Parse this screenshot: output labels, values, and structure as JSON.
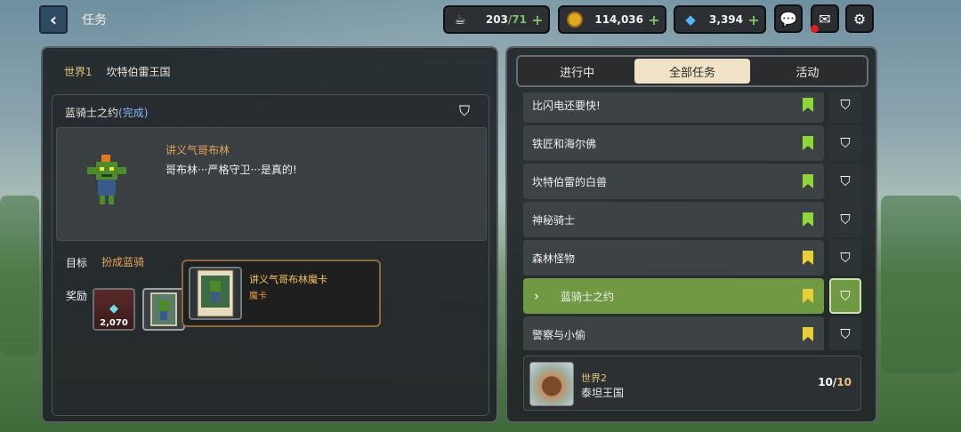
{
  "header": {
    "back_icon": "back-arrow-icon",
    "title": "任务",
    "resources": [
      {
        "name": "stamina",
        "icon": "coffee-cup-icon",
        "value": "203",
        "max": "71"
      },
      {
        "name": "gold",
        "icon": "gold-coin-icon",
        "value": "114,036"
      },
      {
        "name": "gems",
        "icon": "diamond-icon",
        "value": "3,394"
      }
    ],
    "plus_symbol": "+",
    "buttons": [
      "chat-icon",
      "mail-icon",
      "settings-gear-icon"
    ]
  },
  "left": {
    "world_label": "世界1",
    "kingdom": "坎特伯雷王国",
    "quest_title": "蓝骑士之约",
    "quest_status": "(完成)",
    "speaker": "讲义气哥布林",
    "speech": "哥布林···严格守卫···是真的!",
    "goal_label": "目标",
    "goal_text": "扮成蓝骑",
    "reward_label": "奖励",
    "reward_gem_count": "2,070",
    "tooltip": {
      "title": "讲义气哥布林魔卡",
      "type": "魔卡"
    }
  },
  "tabs": [
    "进行中",
    "全部任务",
    "活动"
  ],
  "active_tab": 1,
  "quests": [
    {
      "name": "比闪电还要快!",
      "flag_color": "#8fd63a"
    },
    {
      "name": "铁匠和海尔佛",
      "flag_color": "#8fd63a"
    },
    {
      "name": "坎特伯雷的白兽",
      "flag_color": "#8fd63a"
    },
    {
      "name": "神秘骑士",
      "flag_color": "#8fd63a"
    },
    {
      "name": "森林怪物",
      "flag_color": "#e8cf3a"
    },
    {
      "name": "蓝骑士之约",
      "flag_color": "#e8cf3a",
      "active": true
    },
    {
      "name": "警察与小偷",
      "flag_color": "#e8cf3a"
    }
  ],
  "active_chevron": "›",
  "next_world": {
    "label": "世界2",
    "name": "泰坦王国",
    "progress": "10",
    "total": "10"
  },
  "colors": {
    "active_quest": "#6f9a43",
    "accent_orange": "#e6a35b",
    "completed_blue": "#7db8ee"
  }
}
